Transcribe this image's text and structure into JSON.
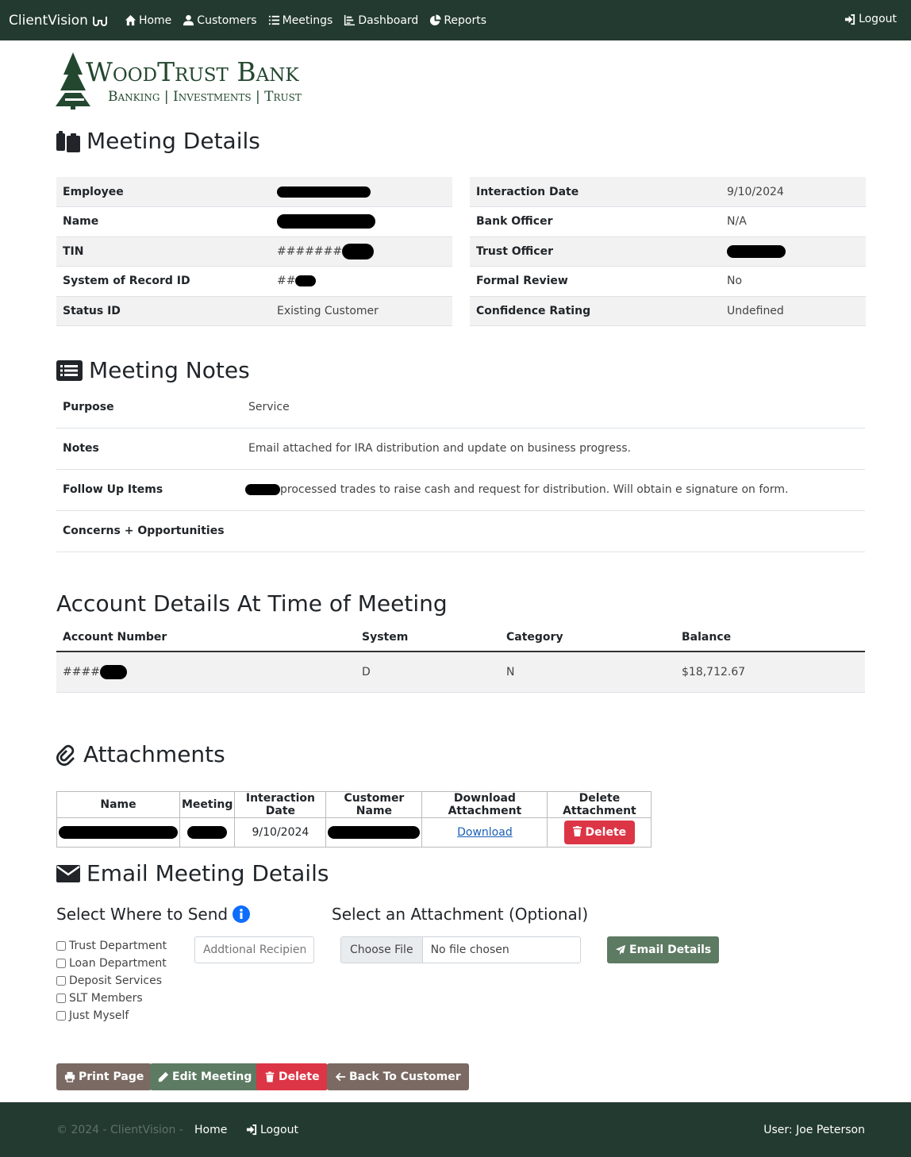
{
  "nav": {
    "brand": "ClientVision",
    "links": [
      "Home",
      "Customers",
      "Meetings",
      "Dashboard",
      "Reports"
    ],
    "logout": "Logout"
  },
  "logo": {
    "title": "WoodTrust Bank",
    "tagline": "Banking | Investments | Trust"
  },
  "meeting_details": {
    "heading": "Meeting Details",
    "left": [
      {
        "label": "Employee",
        "value": ""
      },
      {
        "label": "Name",
        "value": ""
      },
      {
        "label": "TIN",
        "value": "#######"
      },
      {
        "label": "System of Record ID",
        "value": "##"
      },
      {
        "label": "Status ID",
        "value": "Existing Customer"
      }
    ],
    "right": [
      {
        "label": "Interaction Date",
        "value": "9/10/2024"
      },
      {
        "label": "Bank Officer",
        "value": "N/A"
      },
      {
        "label": "Trust Officer",
        "value": ""
      },
      {
        "label": "Formal Review",
        "value": "No"
      },
      {
        "label": "Confidence Rating",
        "value": "Undefined"
      }
    ]
  },
  "meeting_notes": {
    "heading": "Meeting Notes",
    "rows": [
      {
        "label": "Purpose",
        "value": "Service"
      },
      {
        "label": "Notes",
        "value": "Email attached for IRA distribution and update on business progress."
      },
      {
        "label": "Follow Up Items",
        "value": "processed trades to raise cash and request for distribution.  Will obtain e signature on form."
      },
      {
        "label": "Concerns + Opportunities",
        "value": ""
      }
    ]
  },
  "accounts": {
    "heading": "Account Details At Time of Meeting",
    "columns": [
      "Account Number",
      "System",
      "Category",
      "Balance"
    ],
    "rows": [
      {
        "account": "####",
        "system": "D",
        "category": "N",
        "balance": "$18,712.67"
      }
    ]
  },
  "attachments": {
    "heading": "Attachments",
    "columns": [
      "Name",
      "Meeting",
      "Interaction Date",
      "Customer Name",
      "Download Attachment",
      "Delete Attachment"
    ],
    "rows": [
      {
        "name": "",
        "meeting": "",
        "date": "9/10/2024",
        "customer": "",
        "download": "Download",
        "delete": "Delete"
      }
    ]
  },
  "email": {
    "heading": "Email Meeting Details",
    "send_heading": "Select Where to Send",
    "attachment_heading": "Select an Attachment (Optional)",
    "options": [
      "Trust Department",
      "Loan Department",
      "Deposit Services",
      "SLT Members",
      "Just Myself"
    ],
    "recipient_placeholder": "Addtional Recipients",
    "choose_file": "Choose File",
    "no_file": "No file chosen",
    "send_button": "Email Details"
  },
  "actions": {
    "print": "Print Page",
    "edit": "Edit Meeting",
    "delete": "Delete",
    "back": "Back To Customer"
  },
  "footer": {
    "copyright": "© 2024 - ClientVision -",
    "home": "Home",
    "logout": "Logout",
    "user": "User: Joe Peterson"
  },
  "colors": {
    "nav_bg": "#233a30",
    "danger": "#dc3545",
    "success_muted": "#5d7a63",
    "secondary_muted": "#7a6a63"
  }
}
